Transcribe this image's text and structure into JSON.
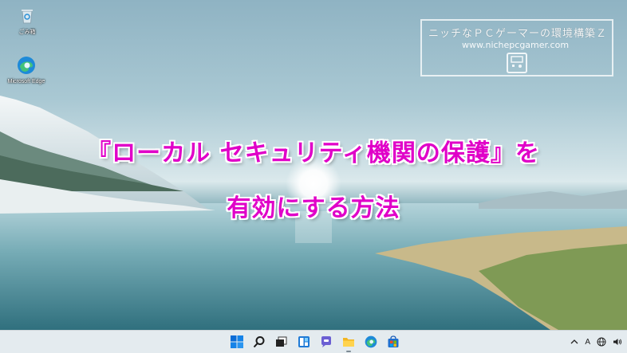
{
  "desktop": {
    "icons": [
      {
        "label": "ごみ箱",
        "icon": "recycle-bin-icon"
      },
      {
        "label": "Microsoft Edge",
        "icon": "edge-icon"
      }
    ]
  },
  "logo": {
    "title": "ニッチなＰＣゲーマーの環境構築Ｚ",
    "url": "www.nichepcgamer.com",
    "icon": "handheld-device-icon"
  },
  "headline": {
    "line1": "『ローカル セキュリティ機関の保護』を",
    "line2": "有効にする方法"
  },
  "taskbar": {
    "apps": [
      {
        "name": "start",
        "icon": "windows-start-icon"
      },
      {
        "name": "search",
        "icon": "search-icon"
      },
      {
        "name": "task-view",
        "icon": "task-view-icon"
      },
      {
        "name": "widgets",
        "icon": "widgets-icon"
      },
      {
        "name": "chat",
        "icon": "teams-chat-icon"
      },
      {
        "name": "file-explorer",
        "icon": "folder-icon"
      },
      {
        "name": "edge",
        "icon": "edge-icon"
      },
      {
        "name": "store",
        "icon": "store-icon"
      }
    ],
    "tray": {
      "ime_label": "A"
    }
  },
  "colors": {
    "headline": "#e000c8",
    "taskbar": "#e4ebef"
  }
}
